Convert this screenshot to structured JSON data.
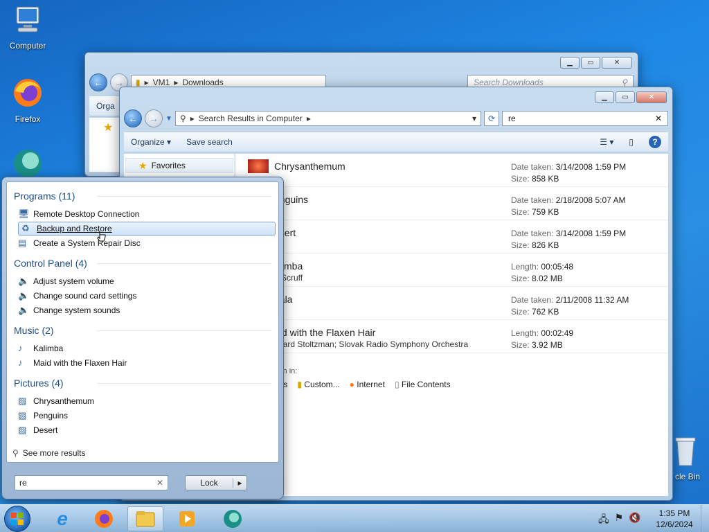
{
  "desktop": {
    "icons": [
      {
        "label": "Computer",
        "icon": "computer-icon"
      },
      {
        "label": "Firefox",
        "icon": "firefox-icon"
      },
      {
        "label": "",
        "icon": "app-globe-icon"
      },
      {
        "label": "cle Bin",
        "icon": "recycle-bin-icon"
      }
    ]
  },
  "window_downloads": {
    "address": [
      "VM1",
      "Downloads"
    ],
    "search_placeholder": "Search Downloads",
    "toolbar_label": "Orga"
  },
  "window_search": {
    "address": "Search Results in Computer",
    "search_value": "re",
    "toolbar": {
      "organize": "Organize",
      "save_search": "Save search"
    },
    "nav": {
      "favorites": "Favorites"
    },
    "results": [
      {
        "name": "Chrysanthemum",
        "sub": "",
        "m1_key": "Date taken:",
        "m1_val": "3/14/2008 1:59 PM",
        "m2_key": "Size:",
        "m2_val": "858 KB",
        "thumb": "#c0281a"
      },
      {
        "name": "enguins",
        "sub": "",
        "m1_key": "Date taken:",
        "m1_val": "2/18/2008 5:07 AM",
        "m2_key": "Size:",
        "m2_val": "759 KB",
        "thumb": ""
      },
      {
        "name": "esert",
        "sub": "",
        "m1_key": "Date taken:",
        "m1_val": "3/14/2008 1:59 PM",
        "m2_key": "Size:",
        "m2_val": "826 KB",
        "thumb": ""
      },
      {
        "name": "alimba",
        "sub": "r. Scruff",
        "m1_key": "Length:",
        "m1_val": "00:05:48",
        "m2_key": "Size:",
        "m2_val": "8.02 MB",
        "thumb": ""
      },
      {
        "name": "bala",
        "sub": "",
        "m1_key": "Date taken:",
        "m1_val": "2/11/2008 11:32 AM",
        "m2_key": "Size:",
        "m2_val": "762 KB",
        "thumb": ""
      },
      {
        "name": "aid with the Flaxen Hair",
        "sub": "chard Stoltzman; Slovak Radio Symphony Orchestra",
        "m1_key": "Length:",
        "m1_val": "00:02:49",
        "m2_key": "Size:",
        "m2_val": "3.92 MB",
        "thumb": ""
      }
    ],
    "search_again": {
      "label": "ain in:",
      "items": [
        "ies",
        "Custom...",
        "Internet",
        "File Contents"
      ]
    }
  },
  "start_menu": {
    "sections": [
      {
        "title": "Programs (11)",
        "items": [
          "Remote Desktop Connection",
          "Backup and Restore",
          "Create a System Repair Disc"
        ]
      },
      {
        "title": "Control Panel (4)",
        "items": [
          "Adjust system volume",
          "Change sound card settings",
          "Change system sounds"
        ]
      },
      {
        "title": "Music (2)",
        "items": [
          "Kalimba",
          "Maid with the Flaxen Hair"
        ]
      },
      {
        "title": "Pictures (4)",
        "items": [
          "Chrysanthemum",
          "Penguins",
          "Desert"
        ]
      }
    ],
    "see_more": "See more results",
    "search_value": "re",
    "lock_label": "Lock"
  },
  "taskbar": {
    "time": "1:35 PM",
    "date": "12/6/2024"
  },
  "colors": {
    "accent": "#1e88e5",
    "selection": "#cfe3f7",
    "section_title": "#1e4e8c"
  }
}
